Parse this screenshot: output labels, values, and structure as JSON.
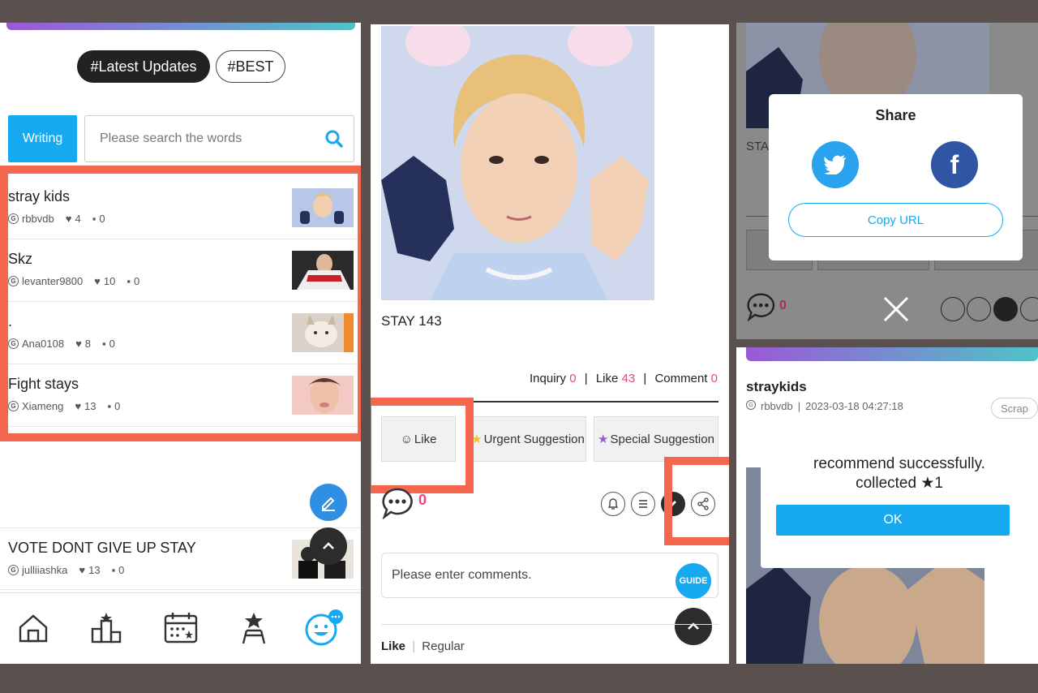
{
  "panel1": {
    "tabs": [
      "#Latest Updates",
      "#BEST"
    ],
    "writing_label": "Writing",
    "search_placeholder": "Please search the words",
    "posts": [
      {
        "title": "stray kids",
        "author": "rbbvdb",
        "likes": "4",
        "comments": "0"
      },
      {
        "title": "Skz",
        "author": "levanter9800",
        "likes": "10",
        "comments": "0"
      },
      {
        "title": ".",
        "author": "Ana0108",
        "likes": "8",
        "comments": "0"
      },
      {
        "title": "Fight stays",
        "author": "Xiameng",
        "likes": "13",
        "comments": "0"
      },
      {
        "title": "VOTE DONT GIVE UP STAY",
        "author": "julliiashka",
        "likes": "13",
        "comments": "0"
      }
    ],
    "bottom_tabs": [
      "home-icon",
      "ranking-icon",
      "calendar-icon",
      "idol-star-icon",
      "smiley-chat-icon"
    ]
  },
  "panel2": {
    "post_title": "STAY 143",
    "inquiry_label": "Inquiry",
    "inquiry_count": "0",
    "like_label": "Like",
    "like_count": "43",
    "comment_label": "Comment",
    "comment_count": "0",
    "like_button": "Like",
    "urgent_button": "Urgent Suggestion",
    "special_button": "Special Suggestion",
    "comment_count_big": "0",
    "comment_placeholder": "Please enter comments.",
    "guide_label": "GUIDE",
    "sort_like": "Like",
    "sort_regular": "Regular"
  },
  "panel3": {
    "share_title": "Share",
    "copy_url": "Copy URL",
    "comment_count": "0",
    "post_title_partial": "STA",
    "post2_title": "straykids",
    "post2_author": "rbbvdb",
    "post2_date": "2023-03-18 04:27:18",
    "scrap_label": "Scrap",
    "dialog_line1": "recommend successfully.",
    "dialog_line2": "collected ★1",
    "ok_label": "OK"
  },
  "colors": {
    "accent_blue": "#17a9f0",
    "highlight_red": "#f4674e",
    "pink_count": "#e8477c",
    "twitter": "#2aa3ef",
    "facebook": "#2f55a4"
  }
}
